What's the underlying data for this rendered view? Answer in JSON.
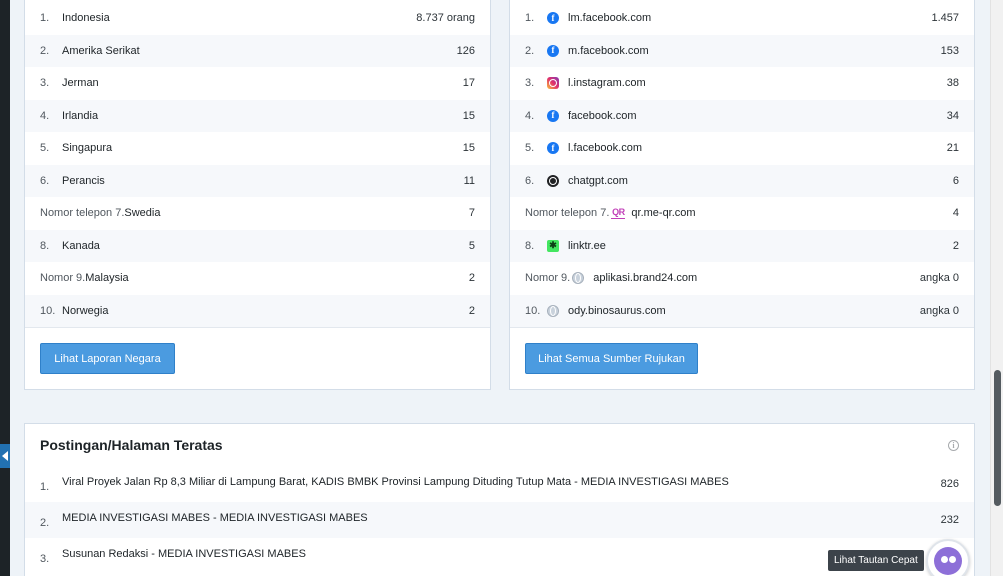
{
  "countries": {
    "rows": [
      {
        "num": "1.",
        "name": "Indonesia",
        "value": "8.737 orang"
      },
      {
        "num": "2.",
        "name": "Amerika Serikat",
        "value": "126"
      },
      {
        "num": "3.",
        "name": "Jerman",
        "value": "17"
      },
      {
        "num": "4.",
        "name": "Irlandia",
        "value": "15"
      },
      {
        "num": "5.",
        "name": "Singapura",
        "value": "15"
      },
      {
        "num": "6.",
        "name": "Perancis",
        "value": "11"
      },
      {
        "num": "Nomor telepon 7.",
        "name": "Swedia",
        "value": "7"
      },
      {
        "num": "8.",
        "name": "Kanada",
        "value": "5"
      },
      {
        "num": "Nomor 9.",
        "name": "Malaysia",
        "value": "2"
      },
      {
        "num": "10.",
        "name": "Norwegia",
        "value": "2"
      }
    ],
    "button_label": "Lihat Laporan Negara"
  },
  "referrers": {
    "rows": [
      {
        "num": "1.",
        "icon": "facebook-icon",
        "glyph": "f",
        "name": "lm.facebook.com",
        "value": "1.457"
      },
      {
        "num": "2.",
        "icon": "facebook-icon",
        "glyph": "f",
        "name": "m.facebook.com",
        "value": "153"
      },
      {
        "num": "3.",
        "icon": "instagram-icon",
        "glyph": "",
        "name": "l.instagram.com",
        "value": "38"
      },
      {
        "num": "4.",
        "icon": "facebook-icon",
        "glyph": "f",
        "name": "facebook.com",
        "value": "34"
      },
      {
        "num": "5.",
        "icon": "facebook-icon",
        "glyph": "f",
        "name": "l.facebook.com",
        "value": "21"
      },
      {
        "num": "6.",
        "icon": "chatgpt-icon",
        "glyph": "",
        "name": "chatgpt.com",
        "value": "6"
      },
      {
        "num": "Nomor telepon 7.",
        "icon": "qr-code-icon",
        "glyph": "QR",
        "name": "qr.me-qr.com",
        "value": "4"
      },
      {
        "num": "8.",
        "icon": "linktree-icon",
        "glyph": "✱",
        "name": "linktr.ee",
        "value": "2"
      },
      {
        "num": "Nomor 9.",
        "icon": "globe-icon",
        "glyph": "",
        "name": "aplikasi.brand24.com",
        "value": "angka 0"
      },
      {
        "num": "10.",
        "icon": "globe-icon",
        "glyph": "",
        "name": "ody.binosaurus.com",
        "value": "angka 0"
      }
    ],
    "button_label": "Lihat Semua Sumber Rujukan"
  },
  "top_posts": {
    "title": "Postingan/Halaman Teratas",
    "rows": [
      {
        "num": "1.",
        "name": "Viral Proyek Jalan Rp 8,3 Miliar di Lampung Barat, KADIS BMBK Provinsi Lampung Dituding Tutup Mata - MEDIA INVESTIGASI MABES",
        "value": "826"
      },
      {
        "num": "2.",
        "name": "MEDIA INVESTIGASI MABES - MEDIA INVESTIGASI MABES",
        "value": "232"
      },
      {
        "num": "3.",
        "name": "Susunan Redaksi - MEDIA INVESTIGASI MABES",
        "value": ""
      }
    ]
  },
  "quick_links_tooltip": "Lihat Tautan Cepat",
  "colors": {
    "accent": "#4b9be0",
    "facebook": "#1877f2",
    "page_bg": "#eef3f8"
  }
}
